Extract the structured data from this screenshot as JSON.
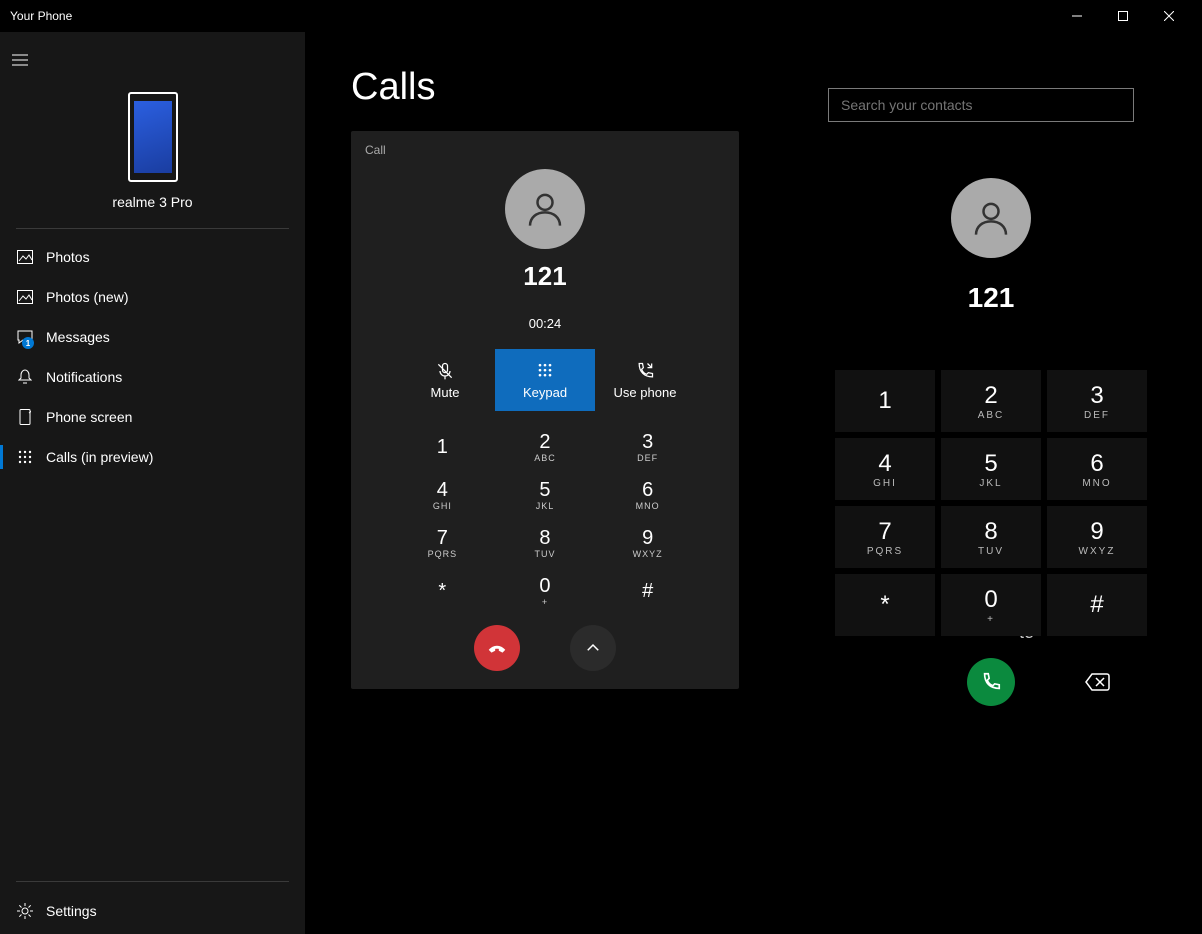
{
  "window": {
    "title": "Your Phone"
  },
  "device": {
    "name": "realme 3 Pro"
  },
  "sidebar": {
    "items": [
      {
        "label": "Photos"
      },
      {
        "label": "Photos (new)"
      },
      {
        "label": "Messages",
        "badge": "1"
      },
      {
        "label": "Notifications"
      },
      {
        "label": "Phone screen"
      },
      {
        "label": "Calls (in preview)"
      }
    ],
    "settings_label": "Settings"
  },
  "calls": {
    "page_title": "Calls",
    "card_label": "Call",
    "number": "121",
    "timer": "00:24",
    "actions": {
      "mute": "Mute",
      "keypad": "Keypad",
      "use_phone": "Use phone"
    }
  },
  "keypad": [
    {
      "d": "1",
      "l": ""
    },
    {
      "d": "2",
      "l": "ABC"
    },
    {
      "d": "3",
      "l": "DEF"
    },
    {
      "d": "4",
      "l": "GHI"
    },
    {
      "d": "5",
      "l": "JKL"
    },
    {
      "d": "6",
      "l": "MNO"
    },
    {
      "d": "7",
      "l": "PQRS"
    },
    {
      "d": "8",
      "l": "TUV"
    },
    {
      "d": "9",
      "l": "WXYZ"
    },
    {
      "d": "*",
      "l": ""
    },
    {
      "d": "0",
      "l": "+"
    },
    {
      "d": "#",
      "l": ""
    }
  ],
  "search": {
    "placeholder": "Search your contacts"
  },
  "dialer": {
    "number": "121"
  },
  "partial_text": "te"
}
